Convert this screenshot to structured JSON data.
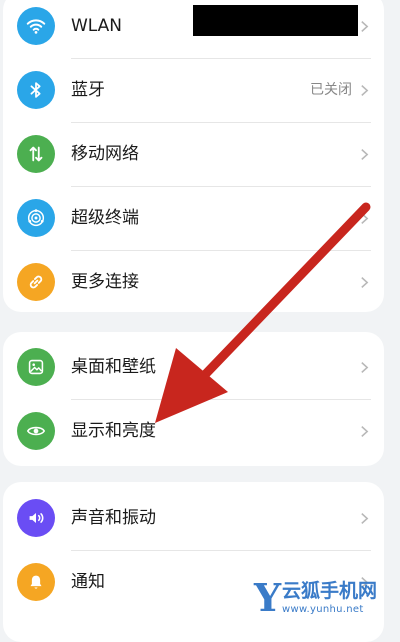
{
  "settings": {
    "group1": [
      {
        "label": "WLAN",
        "icon": "wifi-icon",
        "color": "#2aa6e8",
        "value": ""
      },
      {
        "label": "蓝牙",
        "icon": "bluetooth-icon",
        "color": "#2aa6e8",
        "value": "已关闭"
      },
      {
        "label": "移动网络",
        "icon": "mobile-data-icon",
        "color": "#4caf50",
        "value": ""
      },
      {
        "label": "超级终端",
        "icon": "super-device-icon",
        "color": "#2aa6e8",
        "value": ""
      },
      {
        "label": "更多连接",
        "icon": "link-icon",
        "color": "#f5a623",
        "value": ""
      }
    ],
    "group2": [
      {
        "label": "桌面和壁纸",
        "icon": "wallpaper-icon",
        "color": "#4caf50"
      },
      {
        "label": "显示和亮度",
        "icon": "eye-icon",
        "color": "#4caf50"
      }
    ],
    "group3": [
      {
        "label": "声音和振动",
        "icon": "speaker-icon",
        "color": "#6a4df4"
      },
      {
        "label": "通知",
        "icon": "bell-icon",
        "color": "#f5a623"
      }
    ]
  },
  "annotation": {
    "arrow_color": "#c8261e"
  },
  "watermark": {
    "letter": "Y",
    "name": "云狐手机网",
    "url": "www.yunhu.net"
  }
}
